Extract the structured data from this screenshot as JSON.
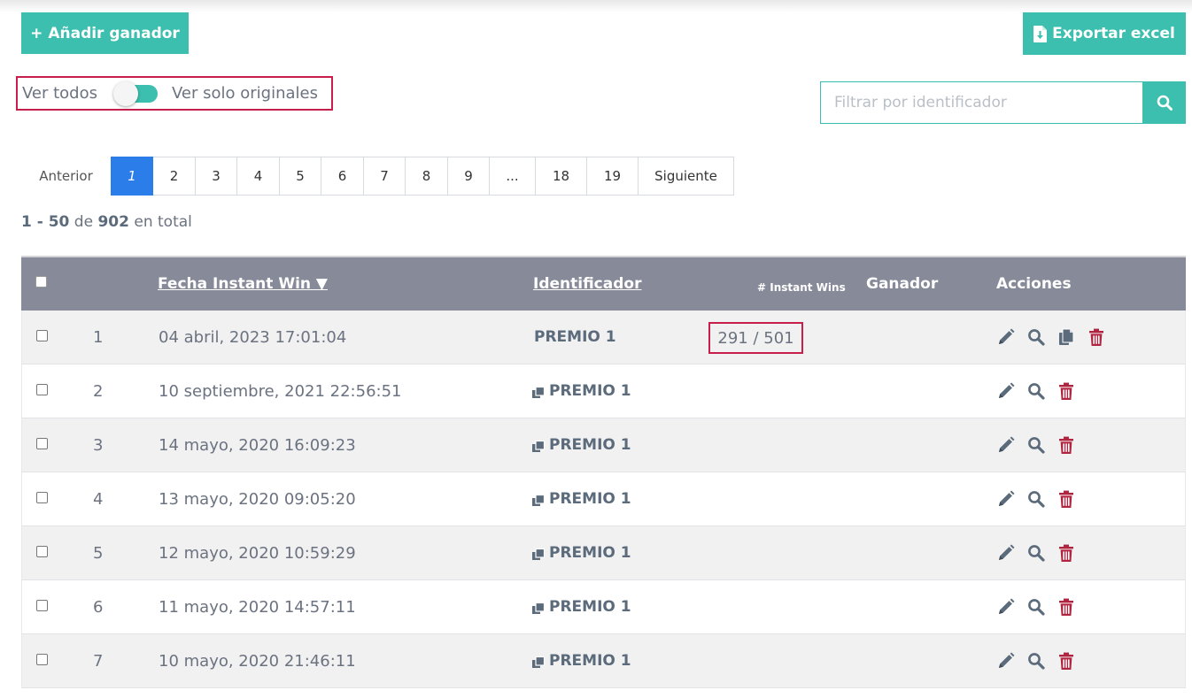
{
  "toolbar": {
    "add_winner_label": "+ Añadir ganador",
    "export_label": "Exportar excel"
  },
  "toggle": {
    "left_label": "Ver todos",
    "right_label": "Ver solo originales",
    "state": "off"
  },
  "search": {
    "placeholder": "Filtrar por identificador",
    "value": ""
  },
  "pagination": {
    "prev_label": "Anterior",
    "pages": [
      "1",
      "2",
      "3",
      "4",
      "5",
      "6",
      "7",
      "8",
      "9",
      "...",
      "18",
      "19"
    ],
    "current": "1",
    "next_label": "Siguiente"
  },
  "summary": {
    "range": "1 - 50",
    "of": "de",
    "total": "902",
    "suffix": "en total"
  },
  "table": {
    "headers": {
      "date": "Fecha Instant Win ▼",
      "identifier": "Identificador",
      "instant_wins": "# Instant Wins",
      "winner": "Ganador",
      "actions": "Acciones"
    },
    "rows": [
      {
        "num": "1",
        "date": "04 abril, 2023 17:01:04",
        "identifier": "PREMIO 1",
        "copy": false,
        "instant_wins": "291 / 501",
        "has_copy_action": true
      },
      {
        "num": "2",
        "date": "10 septiembre, 2021 22:56:51",
        "identifier": "PREMIO 1",
        "copy": true,
        "instant_wins": "",
        "has_copy_action": false
      },
      {
        "num": "3",
        "date": "14 mayo, 2020 16:09:23",
        "identifier": "PREMIO 1",
        "copy": true,
        "instant_wins": "",
        "has_copy_action": false
      },
      {
        "num": "4",
        "date": "13 mayo, 2020 09:05:20",
        "identifier": "PREMIO 1",
        "copy": true,
        "instant_wins": "",
        "has_copy_action": false
      },
      {
        "num": "5",
        "date": "12 mayo, 2020 10:59:29",
        "identifier": "PREMIO 1",
        "copy": true,
        "instant_wins": "",
        "has_copy_action": false
      },
      {
        "num": "6",
        "date": "11 mayo, 2020 14:57:11",
        "identifier": "PREMIO 1",
        "copy": true,
        "instant_wins": "",
        "has_copy_action": false
      },
      {
        "num": "7",
        "date": "10 mayo, 2020 21:46:11",
        "identifier": "PREMIO 1",
        "copy": true,
        "instant_wins": "",
        "has_copy_action": false
      }
    ]
  },
  "colors": {
    "accent": "#3cbfae",
    "header_bg": "#878a99",
    "highlight": "#c81e4c",
    "active_page": "#2b7de9",
    "delete": "#b0243f",
    "icon": "#5b6b7b"
  }
}
